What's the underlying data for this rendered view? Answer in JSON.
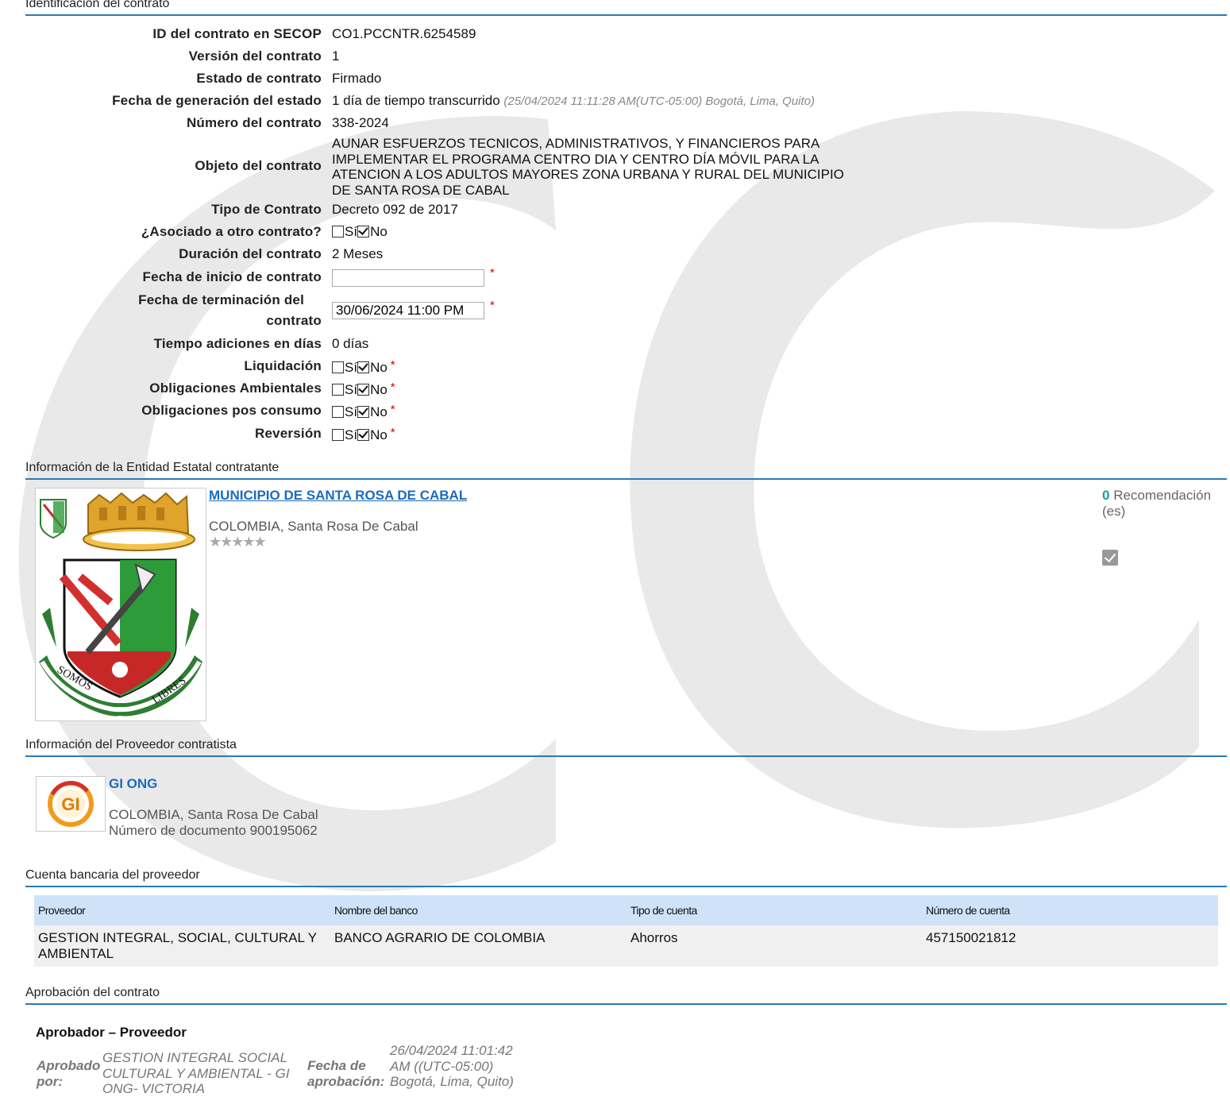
{
  "sections": {
    "identificacion": "Identificación del contrato",
    "entidad": "Información de la Entidad Estatal contratante",
    "proveedor": "Información del Proveedor contratista",
    "cuenta": "Cuenta bancaria del proveedor",
    "aprobacion": "Aprobación del contrato"
  },
  "fields": {
    "id_label": "ID del contrato en SECOP",
    "id_value": "CO1.PCCNTR.6254589",
    "version_label": "Versión del contrato",
    "version_value": "1",
    "estado_label": "Estado de contrato",
    "estado_value": "Firmado",
    "fecha_gen_label": "Fecha de generación del estado",
    "fecha_gen_value": "1 día de tiempo transcurrido",
    "fecha_gen_note": "(25/04/2024 11:11:28 AM(UTC-05:00) Bogotá, Lima, Quito)",
    "numero_label": "Número del contrato",
    "numero_value": "338-2024",
    "objeto_label": "Objeto del contrato",
    "objeto_value": "AUNAR ESFUERZOS TECNICOS, ADMINISTRATIVOS, Y FINANCIEROS PARA IMPLEMENTAR EL PROGRAMA CENTRO DIA Y CENTRO DÍA MÓVIL PARA LA ATENCION A LOS ADULTOS MAYORES ZONA URBANA Y RURAL DEL MUNICIPIO DE SANTA ROSA DE CABAL",
    "tipo_label": "Tipo de Contrato",
    "tipo_value": "Decreto 092 de 2017",
    "asociado_label": "¿Asociado a otro contrato?",
    "duracion_label": "Duración del contrato",
    "duracion_value": "2 Meses",
    "inicio_label": "Fecha de inicio de contrato",
    "inicio_value": "",
    "terminacion_label_1": "Fecha de terminación del",
    "terminacion_label_2": "contrato",
    "terminacion_value": "30/06/2024 11:00 PM",
    "adiciones_label": "Tiempo adiciones en días",
    "adiciones_value": "0 días",
    "liquidacion_label": "Liquidación",
    "ambientales_label": "Obligaciones Ambientales",
    "posconsumo_label": "Obligaciones pos consumo",
    "reversion_label": "Reversión",
    "si": "Sí",
    "no": "No",
    "req": "*"
  },
  "entidad": {
    "name": "MUNICIPIO DE SANTA ROSA DE CABAL",
    "location": "COLOMBIA, Santa Rosa De Cabal",
    "stars": "★★★★★",
    "reco_count": "0",
    "reco_text": " Recomendación (es)",
    "logo_motto_left": "SOMOS",
    "logo_motto_right": "LIBRES"
  },
  "proveedor": {
    "name": "GI ONG",
    "location": "COLOMBIA, Santa Rosa De Cabal",
    "doc": "Número de documento 900195062",
    "logo_text": "GI"
  },
  "bank": {
    "headers": [
      "Proveedor",
      "Nombre del banco",
      "Tipo de cuenta",
      "Número de cuenta"
    ],
    "row": [
      "GESTION INTEGRAL, SOCIAL, CULTURAL Y AMBIENTAL",
      "BANCO AGRARIO DE COLOMBIA",
      "Ahorros",
      "457150021812"
    ]
  },
  "aprobacion": {
    "title": "Aprobador – Proveedor",
    "aprobado_label": "Aprobado por:",
    "aprobado_value": "GESTION INTEGRAL SOCIAL CULTURAL Y AMBIENTAL - GI ONG- VICTORIA",
    "fecha_label": "Fecha de aprobación:",
    "fecha_value": "26/04/2024 11:01:42 AM ((UTC-05:00) Bogotá, Lima, Quito)"
  },
  "colors": {
    "accent": "#2a7ab8",
    "link": "#1a6bbf",
    "table_header": "#cfe3f8",
    "required": "#d10000"
  }
}
